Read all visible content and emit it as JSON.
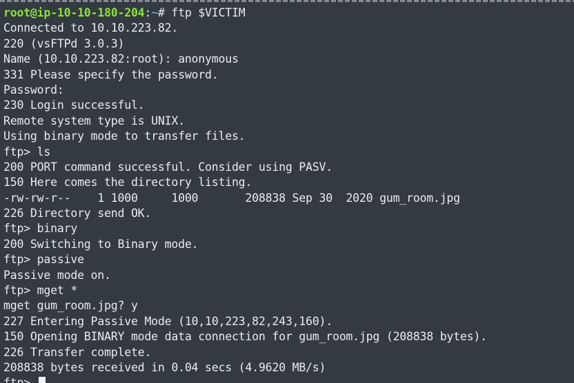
{
  "prompt": {
    "user_host": "root@ip-10-10-180-204",
    "separator": ":",
    "path": "~",
    "symbol": "# ",
    "command": "ftp $VICTIM"
  },
  "lines": [
    "Connected to 10.10.223.82.",
    "220 (vsFTPd 3.0.3)",
    "Name (10.10.223.82:root): anonymous",
    "331 Please specify the password.",
    "Password:",
    "230 Login successful.",
    "Remote system type is UNIX.",
    "Using binary mode to transfer files.",
    "ftp> ls",
    "200 PORT command successful. Consider using PASV.",
    "150 Here comes the directory listing.",
    "-rw-rw-r--    1 1000     1000       208838 Sep 30  2020 gum_room.jpg",
    "226 Directory send OK.",
    "ftp> binary",
    "200 Switching to Binary mode.",
    "ftp> passive",
    "Passive mode on.",
    "ftp> mget *",
    "mget gum_room.jpg? y",
    "227 Entering Passive Mode (10,10,223,82,243,160).",
    "150 Opening BINARY mode data connection for gum_room.jpg (208838 bytes).",
    "226 Transfer complete.",
    "208838 bytes received in 0.04 secs (4.9620 MB/s)"
  ],
  "last_prompt": "ftp> ",
  "colors": {
    "background": "#333a42",
    "text": "#e8ecef",
    "user_host": "#8ae234",
    "path": "#729fcf"
  }
}
